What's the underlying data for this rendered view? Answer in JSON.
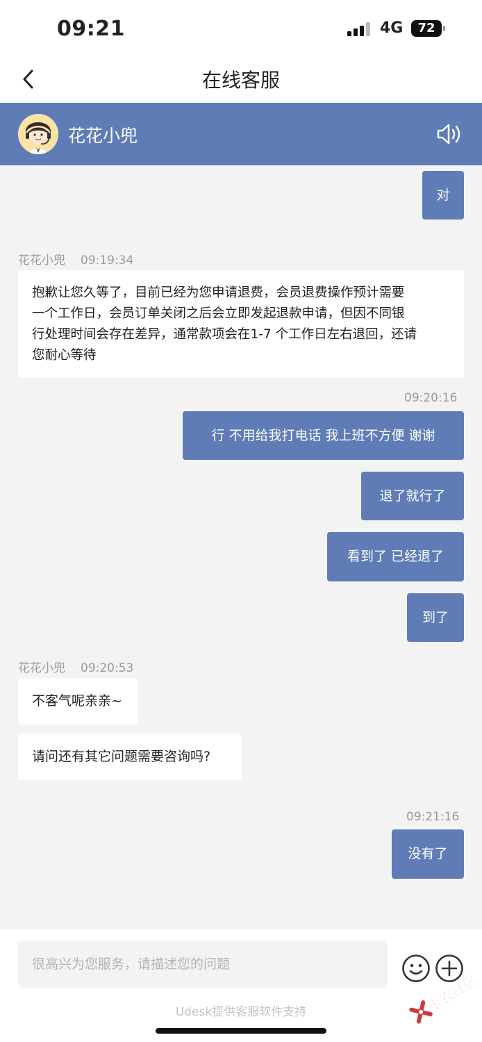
{
  "status_bar": {
    "time": "09:21",
    "network": "4G",
    "battery": "72"
  },
  "nav": {
    "title": "在线客服"
  },
  "agent": {
    "name": "花花小兜"
  },
  "chat": {
    "msg1": "对",
    "meta1_sender": "花花小兜",
    "meta1_time": "09:19:34",
    "msg2_line1": "抱歉让您久等了，目前已经为您申请退费，会员退费操作预计需要",
    "msg2_line2": "一个工作日，会员订单关闭之后会立即发起退款申请，但因不同银",
    "msg2_line3": "行处理时间会存在差异，通常款项会在1-7 个工作日左右退回，还请",
    "msg2_line4": "您耐心等待",
    "time2": "09:20:16",
    "msg3": "行 不用给我打电话 我上班不方便 谢谢",
    "msg4": "退了就行了",
    "msg5": "看到了 已经退了",
    "msg6": "到了",
    "meta2_sender": "花花小兜",
    "meta2_time": "09:20:53",
    "msg7": "不客气呢亲亲~",
    "msg8": "请问还有其它问题需要咨询吗?",
    "time3": "09:21:16",
    "msg9": "没有了"
  },
  "input": {
    "placeholder": "很高兴为您服务，请描述您的问题",
    "powered_by": "Udesk提供客服软件支持"
  },
  "watermark": {
    "text": "卡农社区"
  },
  "colors": {
    "accent": "#5f7cb6",
    "background": "#f3f3f3",
    "bubble_in": "#ffffff",
    "watermark": "#d23a3a"
  },
  "icons": [
    "back-chevron-icon",
    "agent-avatar-icon",
    "speaker-icon",
    "emoji-icon",
    "plus-icon",
    "signal-icon",
    "battery-icon"
  ]
}
